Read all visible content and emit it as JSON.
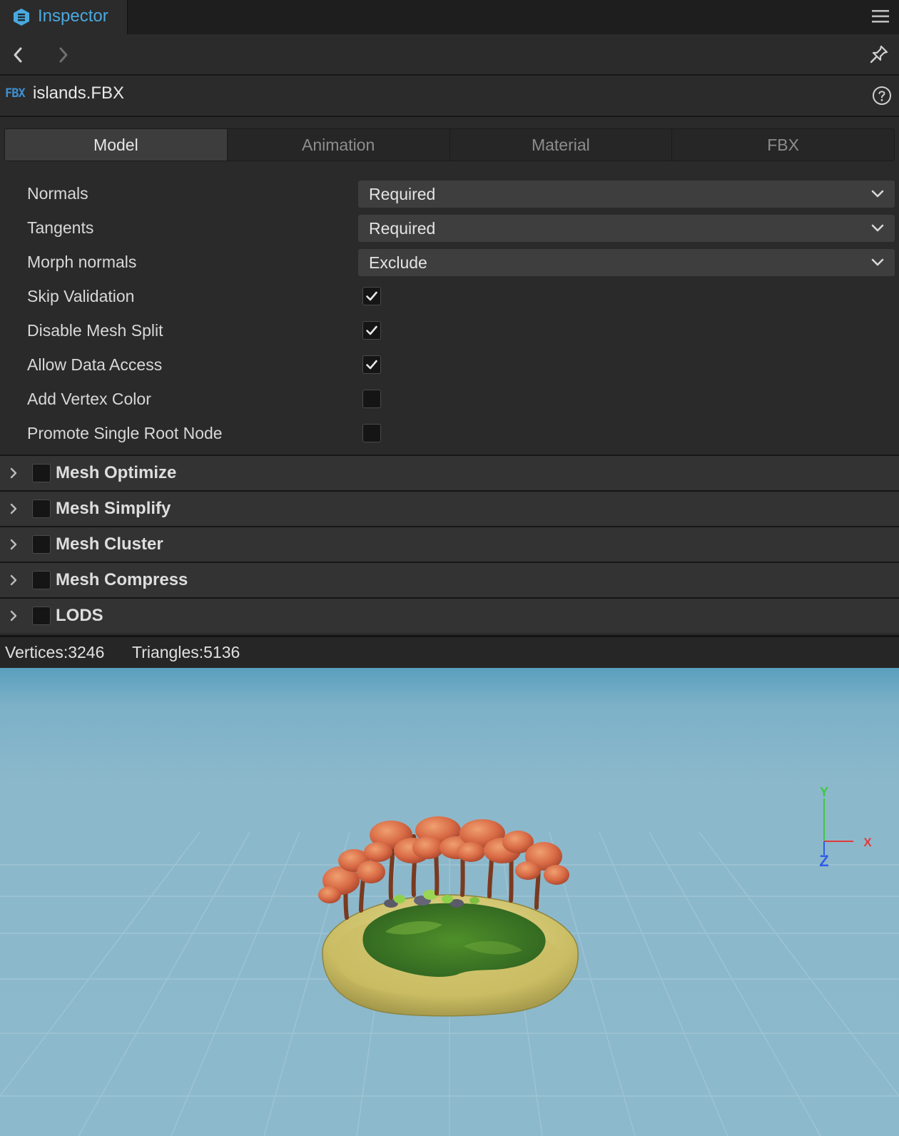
{
  "window": {
    "title": "Inspector",
    "title_color": "#49a9e0"
  },
  "file": {
    "badge": "FBX",
    "name": "islands.FBX"
  },
  "tabs": [
    {
      "label": "Model",
      "active": true
    },
    {
      "label": "Animation",
      "active": false
    },
    {
      "label": "Material",
      "active": false
    },
    {
      "label": "FBX",
      "active": false
    }
  ],
  "properties": {
    "normals": {
      "label": "Normals",
      "value": "Required"
    },
    "tangents": {
      "label": "Tangents",
      "value": "Required"
    },
    "morph_normals": {
      "label": "Morph normals",
      "value": "Exclude"
    },
    "skip_validation": {
      "label": "Skip Validation",
      "checked": true
    },
    "disable_mesh_split": {
      "label": "Disable Mesh Split",
      "checked": true
    },
    "allow_data_access": {
      "label": "Allow Data Access",
      "checked": true
    },
    "add_vertex_color": {
      "label": "Add Vertex Color",
      "checked": false
    },
    "promote_single_root_node": {
      "label": "Promote Single Root Node",
      "checked": false
    }
  },
  "sections": [
    {
      "title": "Mesh Optimize",
      "enabled": false,
      "expanded": false
    },
    {
      "title": "Mesh Simplify",
      "enabled": false,
      "expanded": false
    },
    {
      "title": "Mesh Cluster",
      "enabled": false,
      "expanded": false
    },
    {
      "title": "Mesh Compress",
      "enabled": false,
      "expanded": false
    },
    {
      "title": "LODS",
      "enabled": false,
      "expanded": false
    }
  ],
  "stats": {
    "vertices": "Vertices:3246",
    "triangles": "Triangles:5136"
  },
  "preview": {
    "axis_gizmo": {
      "x_label": "X",
      "y_label": "Y",
      "z_label": "Z",
      "x_color": "#e23b3b",
      "y_color": "#3fc93f",
      "z_color": "#2f5de8"
    }
  }
}
